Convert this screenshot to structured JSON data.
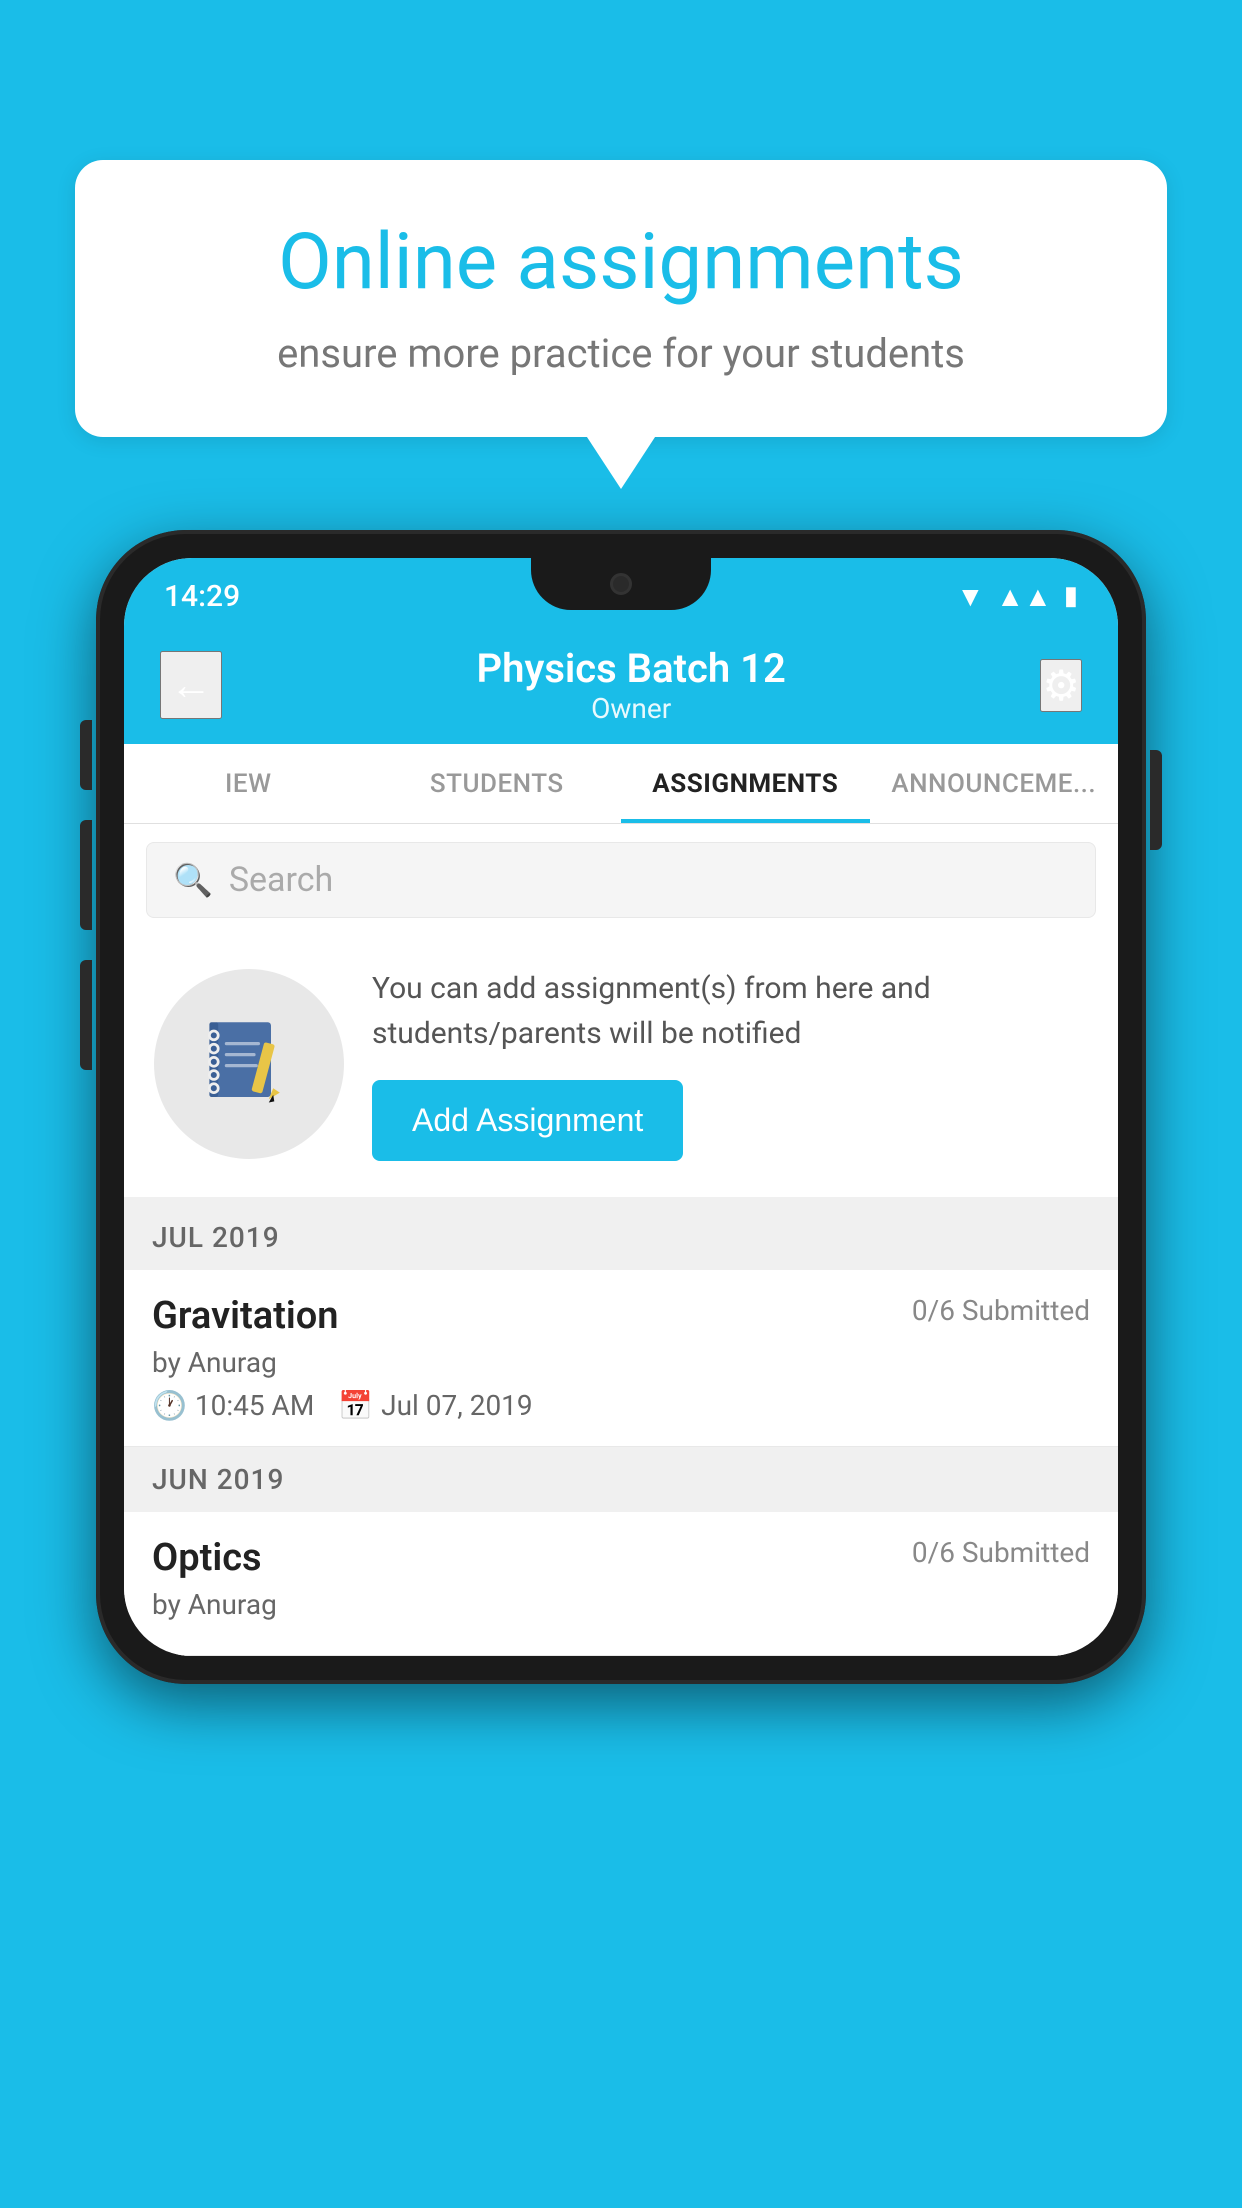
{
  "background_color": "#1ABDE8",
  "speech_bubble": {
    "title": "Online assignments",
    "subtitle": "ensure more practice for your students"
  },
  "status_bar": {
    "time": "14:29",
    "wifi": "▼",
    "signal": "▲",
    "battery": "▮"
  },
  "app_bar": {
    "title": "Physics Batch 12",
    "subtitle": "Owner",
    "back_label": "←",
    "settings_label": "⚙"
  },
  "tabs": [
    {
      "label": "IEW",
      "active": false
    },
    {
      "label": "STUDENTS",
      "active": false
    },
    {
      "label": "ASSIGNMENTS",
      "active": true
    },
    {
      "label": "ANNOUNCEMENTS",
      "active": false
    }
  ],
  "search": {
    "placeholder": "Search"
  },
  "info_card": {
    "description": "You can add assignment(s) from here and students/parents will be notified",
    "button_label": "Add Assignment"
  },
  "sections": [
    {
      "label": "JUL 2019",
      "assignments": [
        {
          "name": "Gravitation",
          "submitted": "0/6 Submitted",
          "by": "by Anurag",
          "time": "10:45 AM",
          "date": "Jul 07, 2019"
        }
      ]
    },
    {
      "label": "JUN 2019",
      "assignments": [
        {
          "name": "Optics",
          "submitted": "0/6 Submitted",
          "by": "by Anurag",
          "time": "",
          "date": ""
        }
      ]
    }
  ]
}
